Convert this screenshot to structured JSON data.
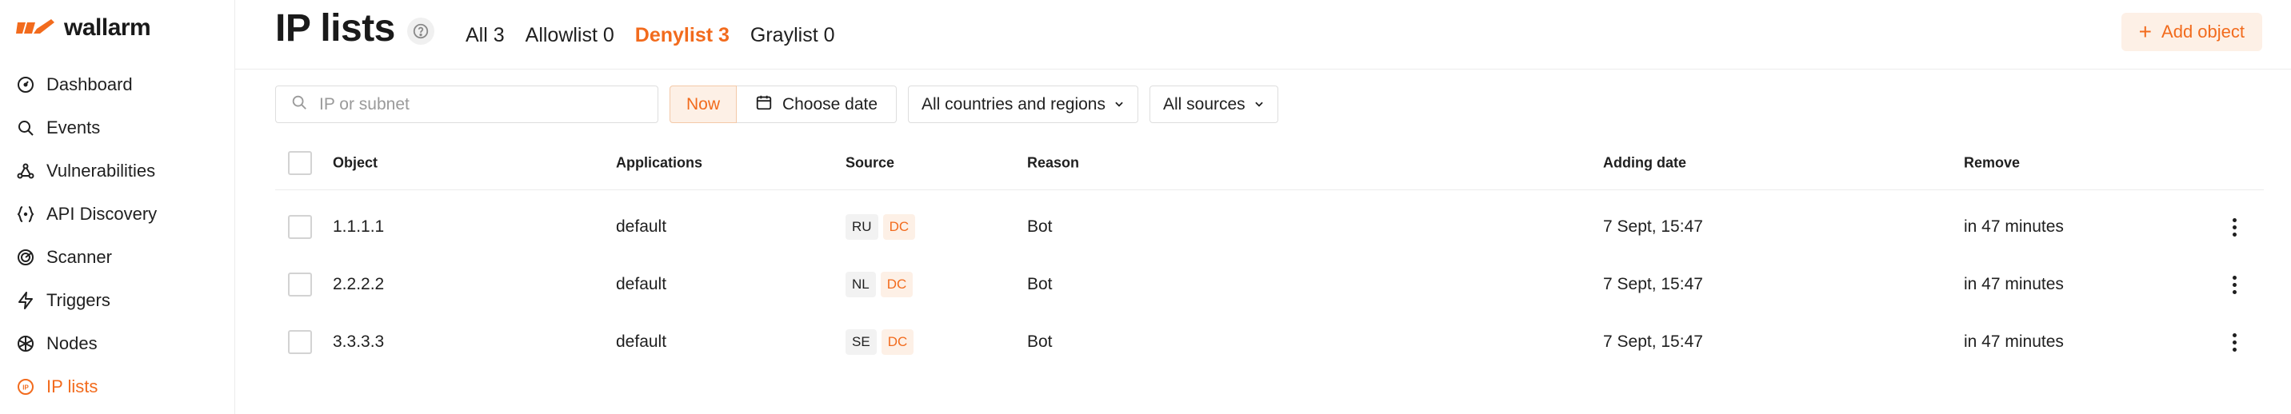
{
  "brand": {
    "name": "wallarm",
    "accent": "#f26b1d"
  },
  "sidebar": {
    "items": [
      {
        "label": "Dashboard",
        "icon": "dashboard-icon"
      },
      {
        "label": "Events",
        "icon": "search-icon"
      },
      {
        "label": "Vulnerabilities",
        "icon": "bug-icon"
      },
      {
        "label": "API Discovery",
        "icon": "api-discovery-icon"
      },
      {
        "label": "Scanner",
        "icon": "scanner-icon"
      },
      {
        "label": "Triggers",
        "icon": "lightning-icon"
      },
      {
        "label": "Nodes",
        "icon": "nodes-icon"
      },
      {
        "label": "IP lists",
        "icon": "ip-icon",
        "active": true
      }
    ]
  },
  "header": {
    "title": "IP lists",
    "tabs": [
      {
        "label": "All 3"
      },
      {
        "label": "Allowlist 0"
      },
      {
        "label": "Denylist 3",
        "active": true
      },
      {
        "label": "Graylist 0"
      }
    ],
    "add_button": "Add object"
  },
  "filters": {
    "search_placeholder": "IP or subnet",
    "now_label": "Now",
    "date_label": "Choose date",
    "countries_label": "All countries and regions",
    "sources_label": "All sources"
  },
  "table": {
    "columns": {
      "object": "Object",
      "applications": "Applications",
      "source": "Source",
      "reason": "Reason",
      "adding_date": "Adding date",
      "remove": "Remove"
    },
    "rows": [
      {
        "object": "1.1.1.1",
        "application": "default",
        "country": "RU",
        "source_tag": "DC",
        "reason": "Bot",
        "adding_date": "7 Sept, 15:47",
        "remove": "in 47 minutes"
      },
      {
        "object": "2.2.2.2",
        "application": "default",
        "country": "NL",
        "source_tag": "DC",
        "reason": "Bot",
        "adding_date": "7 Sept, 15:47",
        "remove": "in 47 minutes"
      },
      {
        "object": "3.3.3.3",
        "application": "default",
        "country": "SE",
        "source_tag": "DC",
        "reason": "Bot",
        "adding_date": "7 Sept, 15:47",
        "remove": "in 47 minutes"
      }
    ]
  }
}
